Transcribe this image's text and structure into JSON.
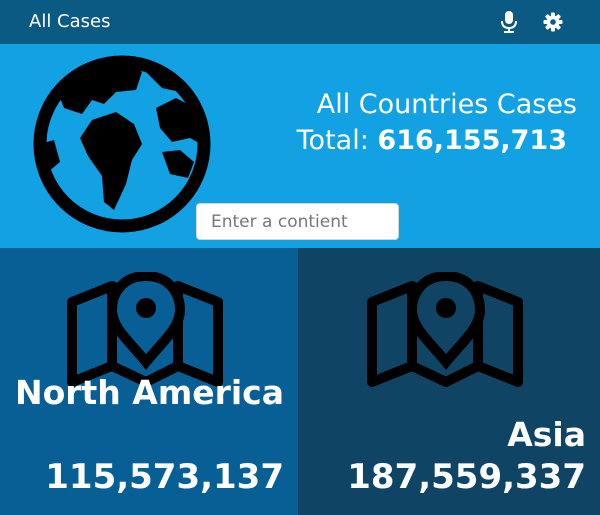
{
  "header": {
    "title": "All Cases",
    "icons": [
      "microphone-icon",
      "gear-icon"
    ]
  },
  "hero": {
    "icon": "globe-icon",
    "title": "All Countries Cases",
    "total_label": "Total:",
    "total_value": "616,155,713",
    "search": {
      "placeholder": "Enter a contient",
      "value": ""
    }
  },
  "continents": [
    {
      "name": "North America",
      "cases": "115,573,137",
      "icon": "map-pin-icon"
    },
    {
      "name": "Asia",
      "cases": "187,559,337",
      "icon": "map-pin-icon"
    }
  ],
  "colors": {
    "header": "#0b5a84",
    "hero": "#12a2e3",
    "tile_left": "#085f96",
    "tile_right": "#0f4465",
    "text": "#ffffff"
  }
}
